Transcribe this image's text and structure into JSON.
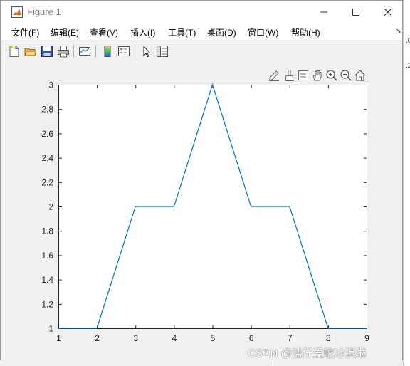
{
  "window": {
    "title": "Figure 1"
  },
  "menu": [
    {
      "label": "文件(F)"
    },
    {
      "label": "编辑(E)"
    },
    {
      "label": "查看(V)"
    },
    {
      "label": "插入(I)"
    },
    {
      "label": "工具(T)"
    },
    {
      "label": "桌面(D)"
    },
    {
      "label": "窗口(W)"
    },
    {
      "label": "帮助(H)"
    }
  ],
  "menu_overflow": "↘",
  "toolbar": {
    "buttons": [
      "new-figure-icon",
      "open-file-icon",
      "save-icon",
      "print-icon",
      "link-plot-icon",
      "insert-colorbar-icon",
      "insert-legend-icon",
      "edit-plot-icon",
      "property-inspector-icon"
    ]
  },
  "axes_toolbar": {
    "buttons": [
      "edit-brush-icon",
      "data-brush-icon",
      "data-tips-icon",
      "pan-icon",
      "zoom-in-icon",
      "zoom-out-icon",
      "home-icon"
    ]
  },
  "chart_data": {
    "type": "line",
    "title": "",
    "xlabel": "",
    "ylabel": "",
    "x": [
      1,
      2,
      3,
      4,
      5,
      6,
      7,
      8,
      9
    ],
    "series": [
      {
        "values": [
          1,
          1,
          2,
          2,
          3,
          2,
          2,
          1,
          1
        ],
        "color": "#0072bd"
      }
    ],
    "xlim": [
      1,
      9
    ],
    "ylim": [
      1,
      3
    ],
    "xticks": [
      "1",
      "2",
      "3",
      "4",
      "5",
      "6",
      "7",
      "8",
      "9"
    ],
    "yticks": [
      "1",
      "1.2",
      "1.4",
      "1.6",
      "1.8",
      "2",
      "2.2",
      "2.4",
      "2.6",
      "2.8",
      "3"
    ],
    "grid": false
  },
  "background_text": [
    ",0",
    ",2"
  ],
  "watermark": "CSDN @洁仔爱吃冰淇淋"
}
